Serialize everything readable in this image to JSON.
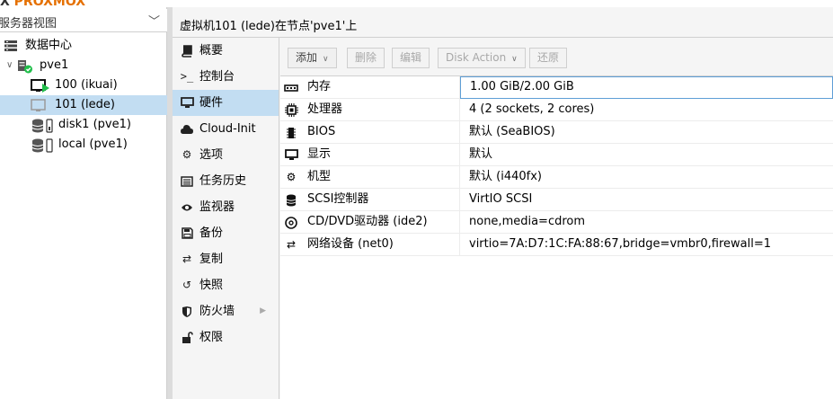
{
  "logo_text": "PROXMOX",
  "tree": {
    "view_selector": "服务器视图",
    "datacenter": "数据中心",
    "node": "pve1",
    "vms": [
      {
        "label": "100 (ikuai)"
      },
      {
        "label": "101 (lede)"
      }
    ],
    "storages": [
      {
        "label": "disk1 (pve1)"
      },
      {
        "label": "local (pve1)"
      }
    ]
  },
  "header": {
    "title": "虚拟机101 (lede)在节点'pve1'上"
  },
  "nav": {
    "items": [
      {
        "label": "概要",
        "icon": "book-icon"
      },
      {
        "label": "控制台",
        "icon": "terminal-icon"
      },
      {
        "label": "硬件",
        "icon": "desktop-icon"
      },
      {
        "label": "Cloud-Init",
        "icon": "cloud-icon"
      },
      {
        "label": "选项",
        "icon": "gear-icon"
      },
      {
        "label": "任务历史",
        "icon": "list-icon"
      },
      {
        "label": "监视器",
        "icon": "eye-icon"
      },
      {
        "label": "备份",
        "icon": "floppy-icon"
      },
      {
        "label": "复制",
        "icon": "retweet-icon"
      },
      {
        "label": "快照",
        "icon": "history-icon"
      },
      {
        "label": "防火墙",
        "icon": "shield-icon"
      },
      {
        "label": "权限",
        "icon": "unlock-icon"
      }
    ]
  },
  "toolbar": {
    "add": "添加",
    "remove": "删除",
    "edit": "编辑",
    "disk_action": "Disk Action",
    "revert": "还原"
  },
  "hardware": [
    {
      "name": "内存",
      "value": "1.00 GiB/2.00 GiB",
      "icon": "memory-icon"
    },
    {
      "name": "处理器",
      "value": "4 (2 sockets, 2 cores)",
      "icon": "cpu-icon"
    },
    {
      "name": "BIOS",
      "value": "默认 (SeaBIOS)",
      "icon": "microchip-icon"
    },
    {
      "name": "显示",
      "value": "默认",
      "icon": "desktop-icon"
    },
    {
      "name": "机型",
      "value": "默认 (i440fx)",
      "icon": "cogs-icon"
    },
    {
      "name": "SCSI控制器",
      "value": "VirtIO SCSI",
      "icon": "database-icon"
    },
    {
      "name": "CD/DVD驱动器 (ide2)",
      "value": "none,media=cdrom",
      "icon": "cdrom-icon"
    },
    {
      "name": "网络设备 (net0)",
      "value": "virtio=7A:D7:1C:FA:88:67,bridge=vmbr0,firewall=1",
      "icon": "exchange-icon"
    }
  ],
  "colors": {
    "selection": "#c2ddf2",
    "running_green": "#21bf4b",
    "accent_orange": "#e57000"
  }
}
